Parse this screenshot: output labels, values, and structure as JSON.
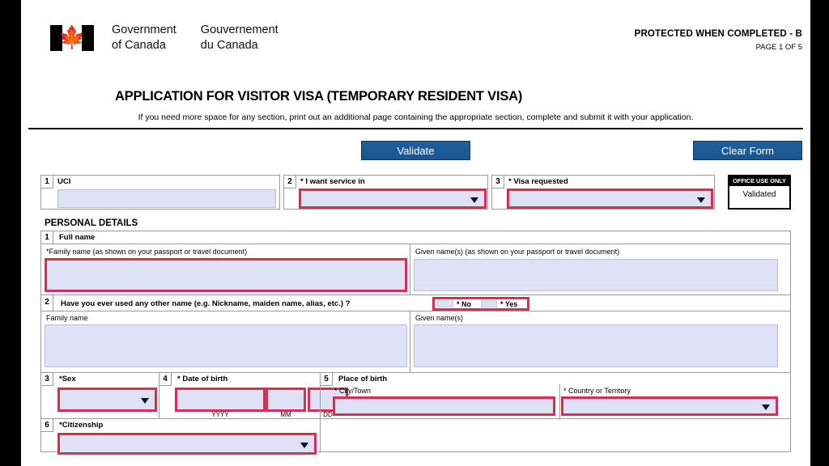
{
  "header": {
    "flag_icon": "canada-flag-icon",
    "gov_en_line1": "Government",
    "gov_en_line2": "of Canada",
    "gov_fr_line1": "Gouvernement",
    "gov_fr_line2": "du Canada",
    "protected_notice": "PROTECTED WHEN COMPLETED - B",
    "page_indicator": "PAGE 1 OF 5"
  },
  "title": {
    "main": "APPLICATION FOR VISITOR VISA (TEMPORARY RESIDENT VISA)",
    "subtitle": "If you need more space for any section, print out an additional page containing the appropriate section, complete and submit it with your application."
  },
  "toolbar": {
    "validate_label": "Validate",
    "clear_label": "Clear Form",
    "button_color": "#1f5fa0"
  },
  "top_fields": {
    "uci": {
      "number": "1",
      "label": "UCI",
      "value": ""
    },
    "service_in": {
      "number": "2",
      "label": "* I want service in",
      "value": "",
      "highlighted": true
    },
    "visa_requested": {
      "number": "3",
      "label": "* Visa requested",
      "value": "",
      "highlighted": true
    },
    "office_use": {
      "header": "OFFICE USE ONLY",
      "body": "Validated"
    }
  },
  "section": {
    "title": "PERSONAL DETAILS"
  },
  "full_name": {
    "number": "1",
    "label": "Full name",
    "family_label": "*Family name  (as shown on your passport or travel document)",
    "family_value": "",
    "given_label": "Given name(s)  (as shown on your passport or travel document)",
    "given_value": ""
  },
  "other_name": {
    "number": "2",
    "question": "Have you ever used any other name (e.g. Nickname, maiden name, alias, etc.) ?",
    "no_label": "* No",
    "yes_label": "* Yes",
    "family_label": "Family name",
    "family_value": "",
    "given_label": "Given name(s)",
    "given_value": ""
  },
  "sex": {
    "number": "3",
    "label": "*Sex",
    "value": ""
  },
  "dob": {
    "number": "4",
    "label": "* Date of birth",
    "yyyy_label": "YYYY",
    "mm_label": "MM",
    "dd_label": "DD",
    "yyyy_value": "",
    "mm_value": "",
    "dd_value": ""
  },
  "place_of_birth": {
    "number": "5",
    "label": "Place of birth",
    "city_label": "* City/Town",
    "city_value": "",
    "country_label": "* Country or Territory",
    "country_value": ""
  },
  "citizenship": {
    "number": "6",
    "label": "*Citizenship",
    "value": ""
  },
  "colors": {
    "highlight_red": "#e02a52",
    "field_fill": "#dfe2f6",
    "button_blue": "#1f5fa0"
  }
}
